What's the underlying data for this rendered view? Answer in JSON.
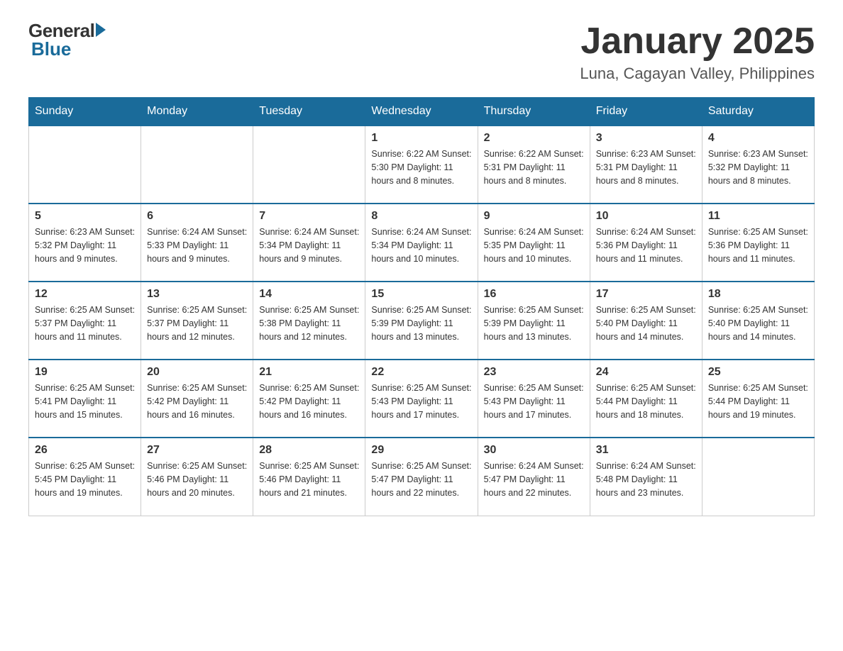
{
  "header": {
    "logo": {
      "general": "General",
      "blue": "Blue"
    },
    "title": "January 2025",
    "location": "Luna, Cagayan Valley, Philippines"
  },
  "days_of_week": [
    "Sunday",
    "Monday",
    "Tuesday",
    "Wednesday",
    "Thursday",
    "Friday",
    "Saturday"
  ],
  "weeks": [
    {
      "cells": [
        {
          "day": "",
          "info": ""
        },
        {
          "day": "",
          "info": ""
        },
        {
          "day": "",
          "info": ""
        },
        {
          "day": "1",
          "info": "Sunrise: 6:22 AM\nSunset: 5:30 PM\nDaylight: 11 hours\nand 8 minutes."
        },
        {
          "day": "2",
          "info": "Sunrise: 6:22 AM\nSunset: 5:31 PM\nDaylight: 11 hours\nand 8 minutes."
        },
        {
          "day": "3",
          "info": "Sunrise: 6:23 AM\nSunset: 5:31 PM\nDaylight: 11 hours\nand 8 minutes."
        },
        {
          "day": "4",
          "info": "Sunrise: 6:23 AM\nSunset: 5:32 PM\nDaylight: 11 hours\nand 8 minutes."
        }
      ]
    },
    {
      "cells": [
        {
          "day": "5",
          "info": "Sunrise: 6:23 AM\nSunset: 5:32 PM\nDaylight: 11 hours\nand 9 minutes."
        },
        {
          "day": "6",
          "info": "Sunrise: 6:24 AM\nSunset: 5:33 PM\nDaylight: 11 hours\nand 9 minutes."
        },
        {
          "day": "7",
          "info": "Sunrise: 6:24 AM\nSunset: 5:34 PM\nDaylight: 11 hours\nand 9 minutes."
        },
        {
          "day": "8",
          "info": "Sunrise: 6:24 AM\nSunset: 5:34 PM\nDaylight: 11 hours\nand 10 minutes."
        },
        {
          "day": "9",
          "info": "Sunrise: 6:24 AM\nSunset: 5:35 PM\nDaylight: 11 hours\nand 10 minutes."
        },
        {
          "day": "10",
          "info": "Sunrise: 6:24 AM\nSunset: 5:36 PM\nDaylight: 11 hours\nand 11 minutes."
        },
        {
          "day": "11",
          "info": "Sunrise: 6:25 AM\nSunset: 5:36 PM\nDaylight: 11 hours\nand 11 minutes."
        }
      ]
    },
    {
      "cells": [
        {
          "day": "12",
          "info": "Sunrise: 6:25 AM\nSunset: 5:37 PM\nDaylight: 11 hours\nand 11 minutes."
        },
        {
          "day": "13",
          "info": "Sunrise: 6:25 AM\nSunset: 5:37 PM\nDaylight: 11 hours\nand 12 minutes."
        },
        {
          "day": "14",
          "info": "Sunrise: 6:25 AM\nSunset: 5:38 PM\nDaylight: 11 hours\nand 12 minutes."
        },
        {
          "day": "15",
          "info": "Sunrise: 6:25 AM\nSunset: 5:39 PM\nDaylight: 11 hours\nand 13 minutes."
        },
        {
          "day": "16",
          "info": "Sunrise: 6:25 AM\nSunset: 5:39 PM\nDaylight: 11 hours\nand 13 minutes."
        },
        {
          "day": "17",
          "info": "Sunrise: 6:25 AM\nSunset: 5:40 PM\nDaylight: 11 hours\nand 14 minutes."
        },
        {
          "day": "18",
          "info": "Sunrise: 6:25 AM\nSunset: 5:40 PM\nDaylight: 11 hours\nand 14 minutes."
        }
      ]
    },
    {
      "cells": [
        {
          "day": "19",
          "info": "Sunrise: 6:25 AM\nSunset: 5:41 PM\nDaylight: 11 hours\nand 15 minutes."
        },
        {
          "day": "20",
          "info": "Sunrise: 6:25 AM\nSunset: 5:42 PM\nDaylight: 11 hours\nand 16 minutes."
        },
        {
          "day": "21",
          "info": "Sunrise: 6:25 AM\nSunset: 5:42 PM\nDaylight: 11 hours\nand 16 minutes."
        },
        {
          "day": "22",
          "info": "Sunrise: 6:25 AM\nSunset: 5:43 PM\nDaylight: 11 hours\nand 17 minutes."
        },
        {
          "day": "23",
          "info": "Sunrise: 6:25 AM\nSunset: 5:43 PM\nDaylight: 11 hours\nand 17 minutes."
        },
        {
          "day": "24",
          "info": "Sunrise: 6:25 AM\nSunset: 5:44 PM\nDaylight: 11 hours\nand 18 minutes."
        },
        {
          "day": "25",
          "info": "Sunrise: 6:25 AM\nSunset: 5:44 PM\nDaylight: 11 hours\nand 19 minutes."
        }
      ]
    },
    {
      "cells": [
        {
          "day": "26",
          "info": "Sunrise: 6:25 AM\nSunset: 5:45 PM\nDaylight: 11 hours\nand 19 minutes."
        },
        {
          "day": "27",
          "info": "Sunrise: 6:25 AM\nSunset: 5:46 PM\nDaylight: 11 hours\nand 20 minutes."
        },
        {
          "day": "28",
          "info": "Sunrise: 6:25 AM\nSunset: 5:46 PM\nDaylight: 11 hours\nand 21 minutes."
        },
        {
          "day": "29",
          "info": "Sunrise: 6:25 AM\nSunset: 5:47 PM\nDaylight: 11 hours\nand 22 minutes."
        },
        {
          "day": "30",
          "info": "Sunrise: 6:24 AM\nSunset: 5:47 PM\nDaylight: 11 hours\nand 22 minutes."
        },
        {
          "day": "31",
          "info": "Sunrise: 6:24 AM\nSunset: 5:48 PM\nDaylight: 11 hours\nand 23 minutes."
        },
        {
          "day": "",
          "info": ""
        }
      ]
    }
  ]
}
